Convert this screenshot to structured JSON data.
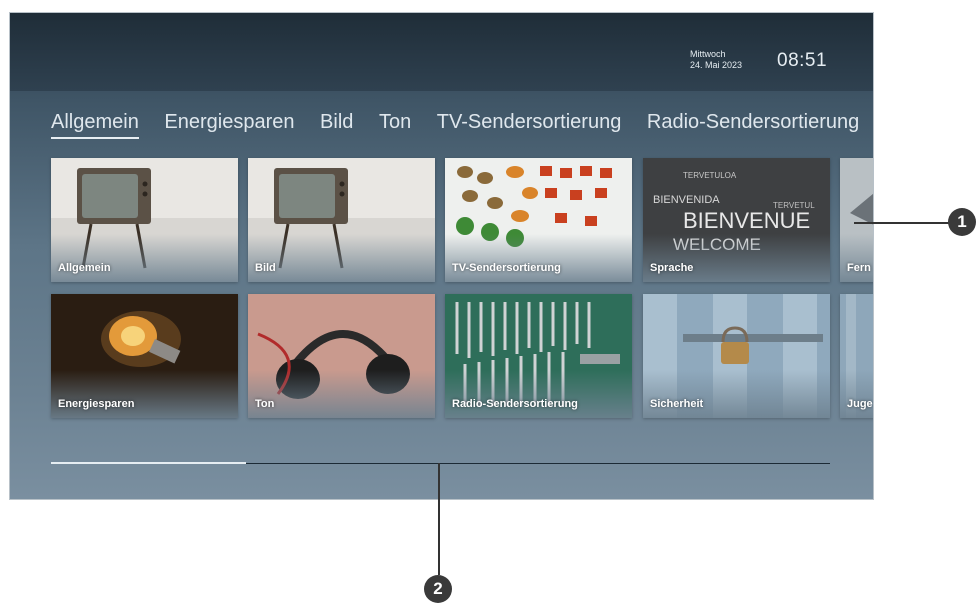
{
  "header": {
    "weekday": "Mittwoch",
    "date": "24. Mai 2023",
    "time": "08:51"
  },
  "tabs": [
    {
      "label": "Allgemein",
      "active": true
    },
    {
      "label": "Energiesparen"
    },
    {
      "label": "Bild"
    },
    {
      "label": "Ton"
    },
    {
      "label": "TV-Sendersortierung"
    },
    {
      "label": "Radio-Sendersortierung"
    }
  ],
  "tiles_row1": [
    {
      "label": "Allgemein",
      "icon": "tv-image"
    },
    {
      "label": "Bild",
      "icon": "tv-image"
    },
    {
      "label": "TV-Sendersortierung",
      "icon": "vegetables-image"
    },
    {
      "label": "Sprache",
      "icon": "welcome-words-image"
    },
    {
      "label": "Fern",
      "icon": "remote-image"
    }
  ],
  "tiles_row2": [
    {
      "label": "Energiesparen",
      "icon": "light-bulb-image"
    },
    {
      "label": "Ton",
      "icon": "headphones-image"
    },
    {
      "label": "Radio-Sendersortierung",
      "icon": "wrenches-image"
    },
    {
      "label": "Sicherheit",
      "icon": "padlock-image"
    },
    {
      "label": "Juge",
      "icon": "door-image"
    }
  ],
  "scroll_progress": 0.25,
  "callouts": [
    "1",
    "2"
  ],
  "colors": {
    "accent": "#e6edf2",
    "callout": "#3a3a3a"
  }
}
